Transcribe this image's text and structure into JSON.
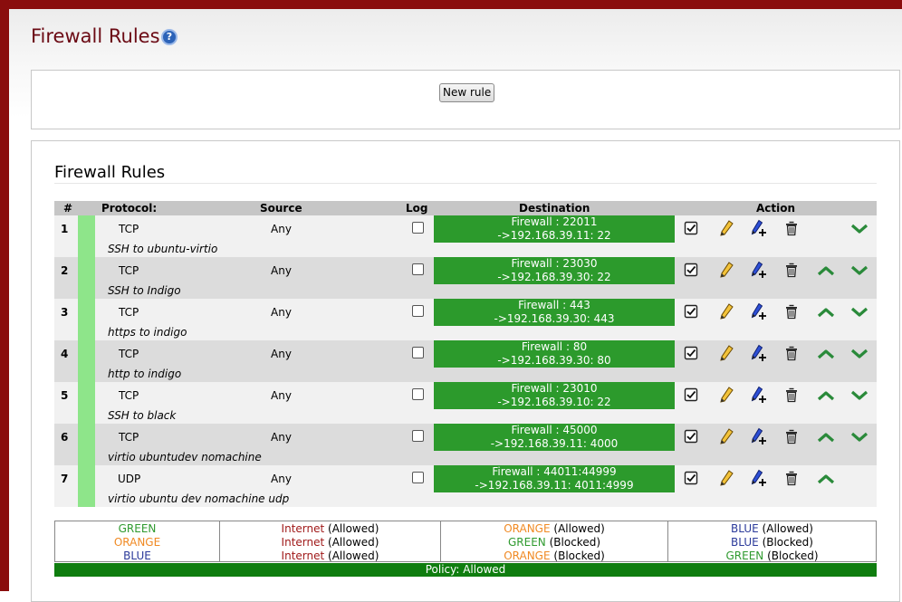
{
  "page": {
    "title": "Firewall Rules",
    "help_icon": "question-circle-icon"
  },
  "toolbar": {
    "new_rule_label": "New rule"
  },
  "rules_section": {
    "title": "Firewall Rules",
    "headers": {
      "num": "#",
      "protocol": "Protocol:",
      "source": "Source",
      "log": "Log",
      "destination": "Destination",
      "action": "Action"
    }
  },
  "rules": [
    {
      "num": "1",
      "protocol": "TCP",
      "source": "Any",
      "dest_line1": "Firewall : 22011",
      "dest_line2": "->192.168.39.11: 22",
      "comment": "SSH to ubuntu-virtio",
      "log": false,
      "enabled": true
    },
    {
      "num": "2",
      "protocol": "TCP",
      "source": "Any",
      "dest_line1": "Firewall : 23030",
      "dest_line2": "->192.168.39.30: 22",
      "comment": "SSH to Indigo",
      "log": false,
      "enabled": true
    },
    {
      "num": "3",
      "protocol": "TCP",
      "source": "Any",
      "dest_line1": "Firewall : 443",
      "dest_line2": "->192.168.39.30: 443",
      "comment": "https to indigo",
      "log": false,
      "enabled": true
    },
    {
      "num": "4",
      "protocol": "TCP",
      "source": "Any",
      "dest_line1": "Firewall : 80",
      "dest_line2": "->192.168.39.30: 80",
      "comment": "http to indigo",
      "log": false,
      "enabled": true
    },
    {
      "num": "5",
      "protocol": "TCP",
      "source": "Any",
      "dest_line1": "Firewall : 23010",
      "dest_line2": "->192.168.39.10: 22",
      "comment": "SSH to black",
      "log": false,
      "enabled": true
    },
    {
      "num": "6",
      "protocol": "TCP",
      "source": "Any",
      "dest_line1": "Firewall : 45000",
      "dest_line2": "->192.168.39.11: 4000",
      "comment": "virtio ubuntudev nomachine",
      "log": false,
      "enabled": true
    },
    {
      "num": "7",
      "protocol": "UDP",
      "source": "Any",
      "dest_line1": "Firewall : 44011:44999",
      "dest_line2": "->192.168.39.11: 4011:4999",
      "comment": "virtio ubuntu dev nomachine udp",
      "log": false,
      "enabled": true
    }
  ],
  "legend": {
    "col1": [
      "GREEN",
      "ORANGE",
      "BLUE"
    ],
    "col2": [
      {
        "zone": "Internet",
        "status": "(Allowed)"
      },
      {
        "zone": "Internet",
        "status": "(Allowed)"
      },
      {
        "zone": "Internet",
        "status": "(Allowed)"
      }
    ],
    "col3": [
      {
        "zone": "ORANGE",
        "status": "(Allowed)"
      },
      {
        "zone": "GREEN",
        "status": "(Blocked)"
      },
      {
        "zone": "ORANGE",
        "status": "(Blocked)"
      }
    ],
    "col4": [
      {
        "zone": "BLUE",
        "status": "(Allowed)"
      },
      {
        "zone": "BLUE",
        "status": "(Blocked)"
      },
      {
        "zone": "GREEN",
        "status": "(Blocked)"
      }
    ]
  },
  "policy": "Policy: Allowed",
  "colors": {
    "brand_red": "#8a0d0d",
    "title_red": "#6b0a14",
    "dest_green": "#2c9a2c",
    "policy_green": "#0f7d0f",
    "rule_mark_green": "#8ee58a",
    "zone_green": "#2f9a2f",
    "zone_orange": "#f08a24",
    "zone_blue": "#2b3a9a",
    "zone_internet": "#a01a1a"
  },
  "icons": {
    "enable": "checkbox-checked-icon",
    "edit": "pencil-edit-icon",
    "duplicate": "pencil-add-icon",
    "delete": "trash-icon",
    "move_up": "arrow-up-icon",
    "move_down": "arrow-down-icon"
  }
}
